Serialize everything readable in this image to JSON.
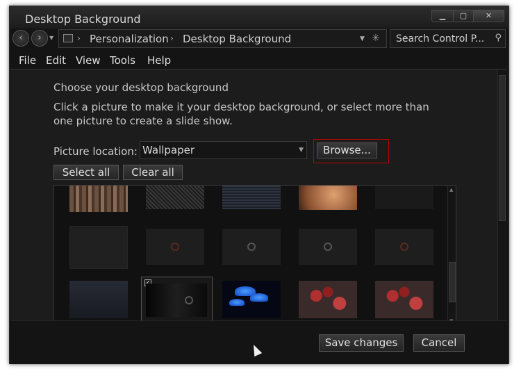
{
  "window": {
    "title": "Desktop Background"
  },
  "nav": {
    "breadcrumbs": [
      "Personalization",
      "Desktop Background"
    ],
    "search_placeholder": "Search Control P..."
  },
  "menu": [
    "File",
    "Edit",
    "View",
    "Tools",
    "Help"
  ],
  "main": {
    "heading": "Choose your desktop background",
    "description": "Click a picture to make it your desktop background, or select more than one picture to create a slide show.",
    "location_label": "Picture location:",
    "location_value": "Wallpaper",
    "browse_label": "Browse...",
    "select_all_label": "Select all",
    "clear_all_label": "Clear all"
  },
  "gallery": {
    "rows": [
      [
        "wood",
        "mesh",
        "stripe",
        "peach",
        "faint"
      ],
      [
        "dark",
        "dark-logo",
        "dark-logo",
        "dark-logo",
        "dark-logo"
      ],
      [
        "navy",
        "selected-black",
        "blue-mushrooms",
        "red-pattern",
        "red-pattern"
      ]
    ],
    "selected_tile": "selected-black"
  },
  "footer": {
    "save_label": "Save changes",
    "cancel_label": "Cancel"
  },
  "colors": {
    "highlight": "#c00000",
    "background": "#141414"
  }
}
